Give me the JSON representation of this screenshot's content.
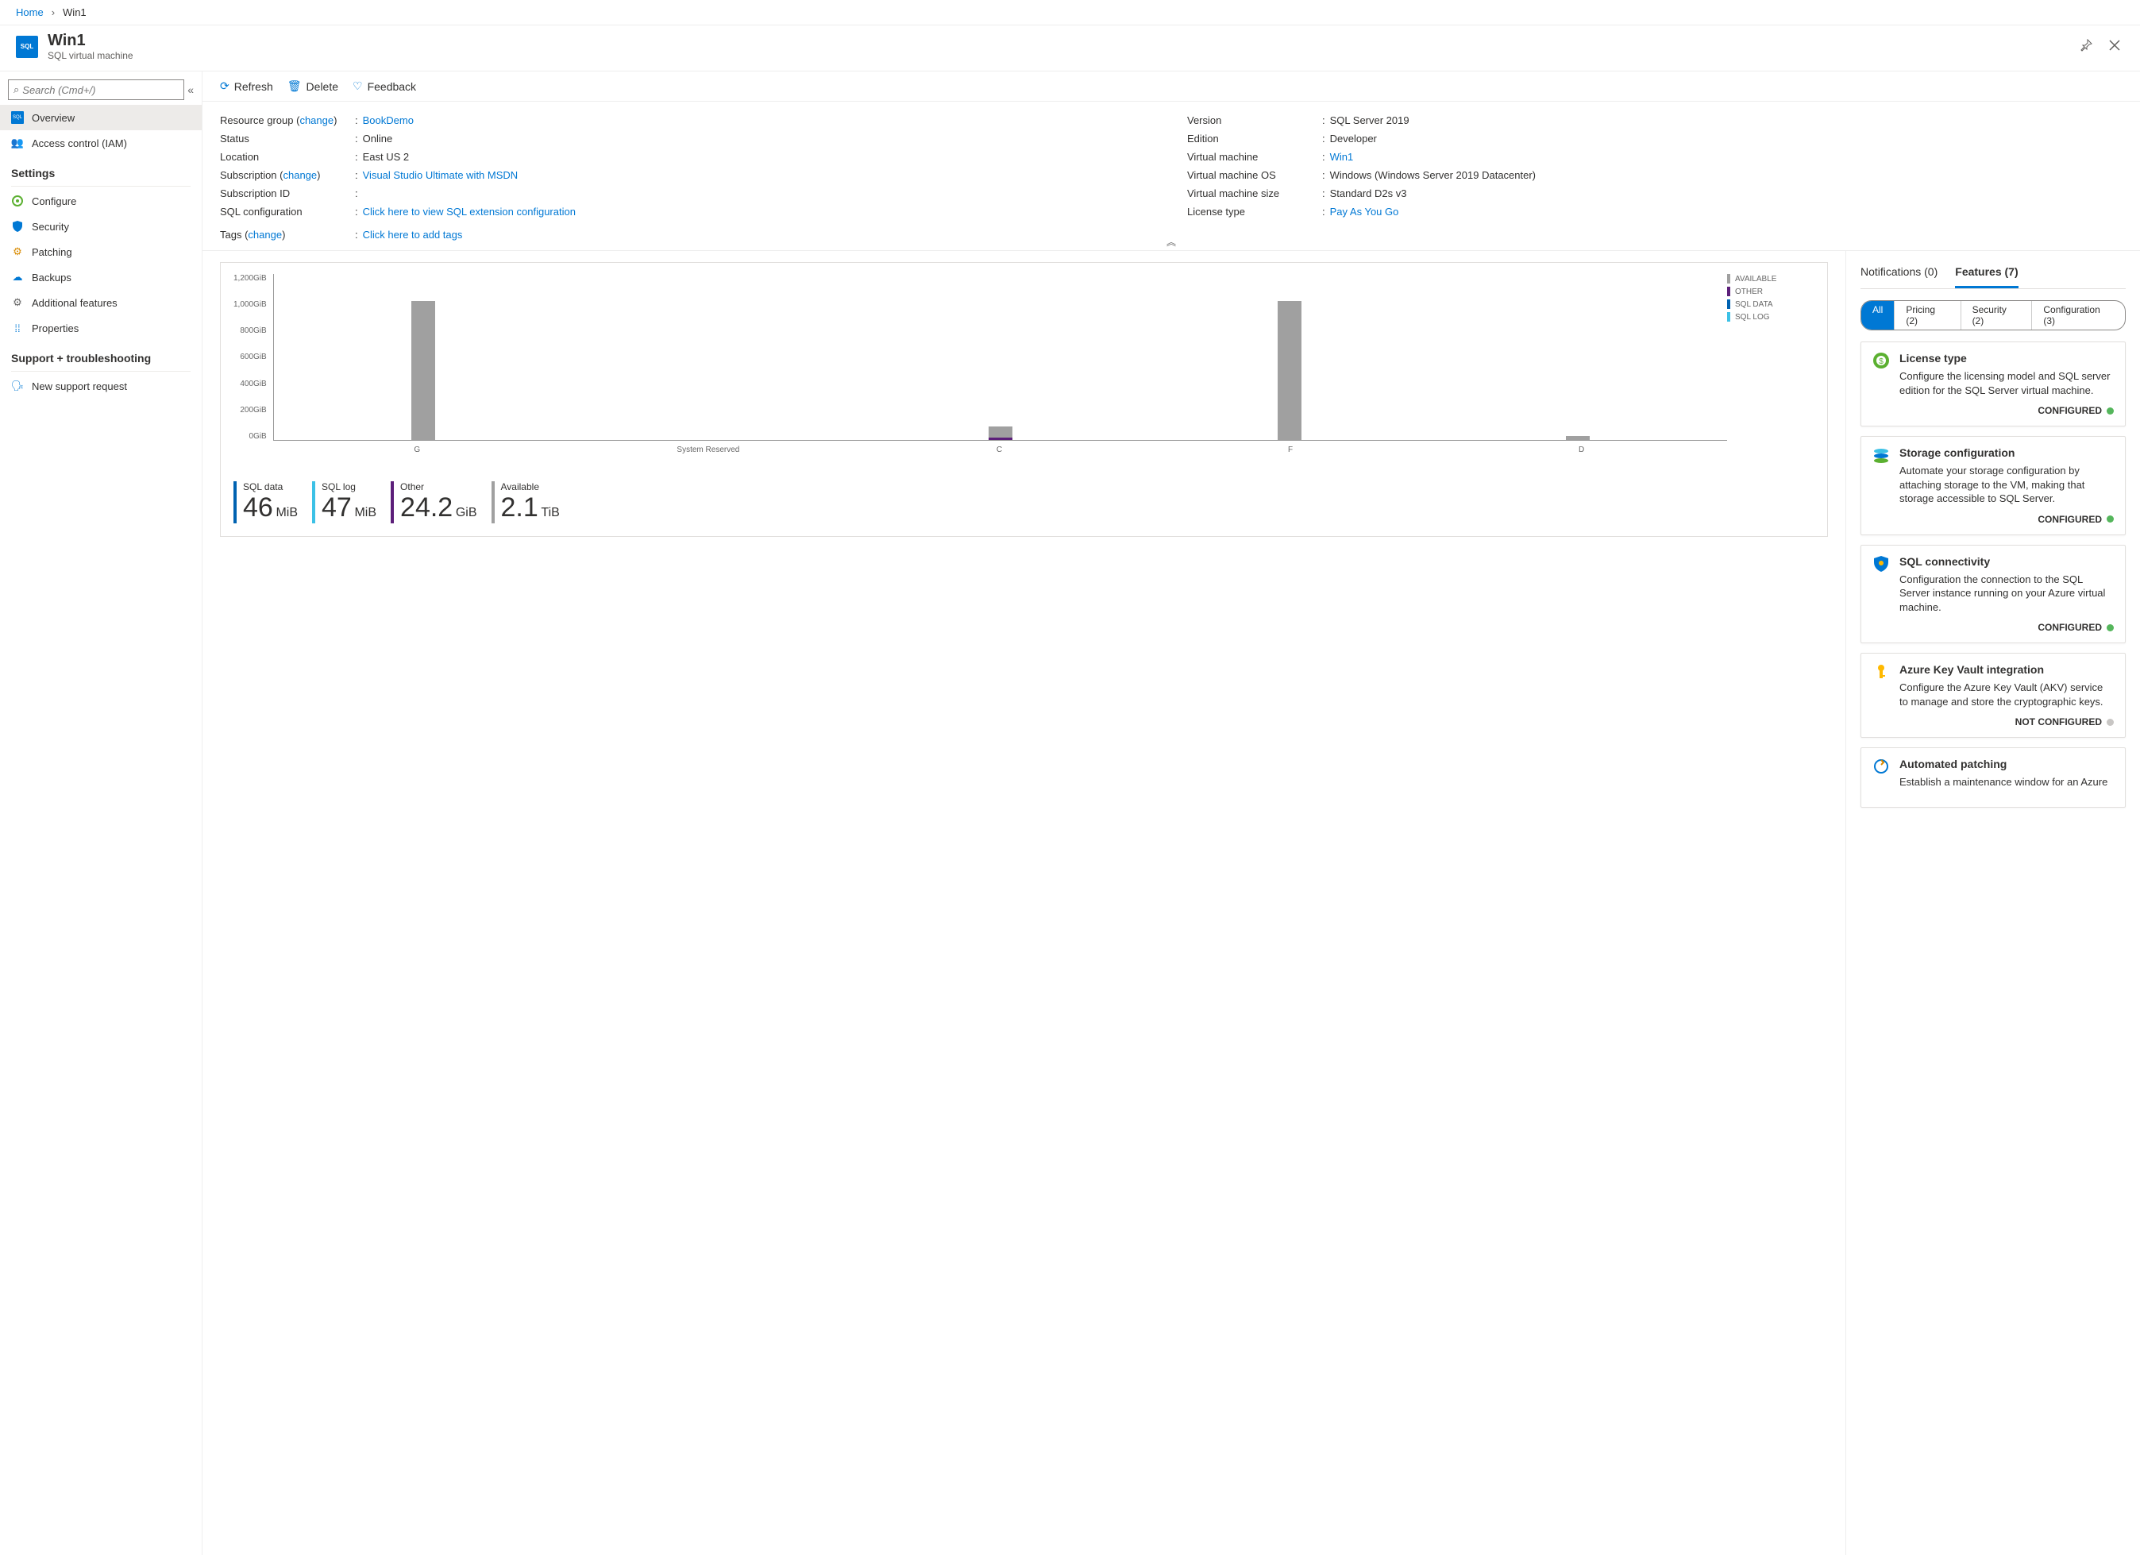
{
  "breadcrumb": {
    "home": "Home",
    "current": "Win1"
  },
  "header": {
    "title": "Win1",
    "subtitle": "SQL virtual machine"
  },
  "search": {
    "placeholder": "Search (Cmd+/)"
  },
  "nav": {
    "overview": "Overview",
    "iam": "Access control (IAM)",
    "settings_header": "Settings",
    "configure": "Configure",
    "security": "Security",
    "patching": "Patching",
    "backups": "Backups",
    "additional": "Additional features",
    "properties": "Properties",
    "support_header": "Support + troubleshooting",
    "support_request": "New support request"
  },
  "toolbar": {
    "refresh": "Refresh",
    "delete": "Delete",
    "feedback": "Feedback"
  },
  "props_left": {
    "rg": {
      "label": "Resource group (",
      "change": "change",
      "end": ") ",
      "value": "BookDemo"
    },
    "status": {
      "label": "Status",
      "value": "Online"
    },
    "location": {
      "label": "Location",
      "value": "East US 2"
    },
    "subscription": {
      "label": "Subscription (",
      "change": "change",
      "end": ")",
      "value": "Visual Studio Ultimate with MSDN"
    },
    "subscription_id": {
      "label": "Subscription ID",
      "value": ""
    },
    "sql_config": {
      "label": "SQL configuration",
      "value": "Click here to view SQL extension configuration"
    },
    "tags": {
      "label": "Tags (",
      "change": "change",
      "end": ")",
      "value": "Click here to add tags"
    }
  },
  "props_right": {
    "version": {
      "label": "Version",
      "value": "SQL Server 2019"
    },
    "edition": {
      "label": "Edition",
      "value": "Developer"
    },
    "vm": {
      "label": "Virtual machine",
      "value": "Win1"
    },
    "vm_os": {
      "label": "Virtual machine OS",
      "value": "Windows (Windows Server 2019 Datacenter)"
    },
    "vm_size": {
      "label": "Virtual machine size",
      "value": "Standard D2s v3"
    },
    "license": {
      "label": "License type",
      "value": "Pay As You Go"
    }
  },
  "chart_data": {
    "type": "bar",
    "categories": [
      "G",
      "System Reserved",
      "C",
      "F",
      "D"
    ],
    "values": [
      1000,
      0,
      100,
      1000,
      30
    ],
    "ylabel": "GiB",
    "ylim": [
      0,
      1200
    ],
    "y_ticks": [
      "1,200GiB",
      "1,000GiB",
      "800GiB",
      "600GiB",
      "400GiB",
      "200GiB",
      "0GiB"
    ],
    "legend": [
      "AVAILABLE",
      "OTHER",
      "SQL DATA",
      "SQL LOG"
    ],
    "legend_colors": [
      "#a0a0a0",
      "#5c1f7a",
      "#0062b1",
      "#3cc1e6"
    ],
    "other_overlay": {
      "C": 18
    }
  },
  "metrics": {
    "sqldata": {
      "label": "SQL data",
      "value": "46",
      "unit": "MiB"
    },
    "sqllog": {
      "label": "SQL log",
      "value": "47",
      "unit": "MiB"
    },
    "other": {
      "label": "Other",
      "value": "24.2",
      "unit": "GiB"
    },
    "available": {
      "label": "Available",
      "value": "2.1",
      "unit": "TiB"
    }
  },
  "tabs": {
    "notifications": "Notifications (0)",
    "features": "Features (7)"
  },
  "pills": {
    "all": "All",
    "pricing": "Pricing (2)",
    "security": "Security (2)",
    "configuration": "Configuration (3)"
  },
  "cards": [
    {
      "title": "License type",
      "desc": "Configure the licensing model and SQL server edition for the SQL Server virtual machine.",
      "status": "CONFIGURED",
      "dot": "green",
      "icon": "dollar"
    },
    {
      "title": "Storage configuration",
      "desc": "Automate your storage configuration by attaching storage to the VM, making that storage accessible to SQL Server.",
      "status": "CONFIGURED",
      "dot": "green",
      "icon": "disks"
    },
    {
      "title": "SQL connectivity",
      "desc": "Configuration the connection to the SQL Server instance running on your Azure virtual machine.",
      "status": "CONFIGURED",
      "dot": "green",
      "icon": "shield"
    },
    {
      "title": "Azure Key Vault integration",
      "desc": "Configure the Azure Key Vault (AKV) service to manage and store the cryptographic keys.",
      "status": "NOT CONFIGURED",
      "dot": "gray",
      "icon": "key"
    },
    {
      "title": "Automated patching",
      "desc": "Establish a maintenance window for an Azure",
      "status": "",
      "dot": "",
      "icon": "patch"
    }
  ]
}
